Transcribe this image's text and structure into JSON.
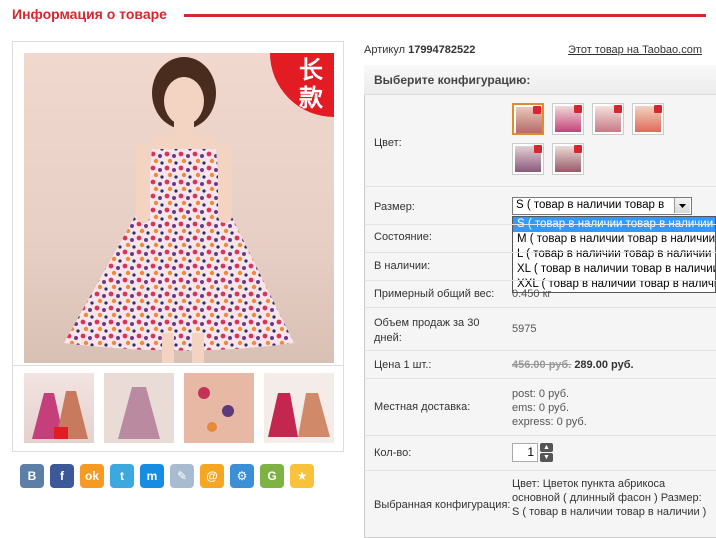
{
  "header": {
    "title": "Информация о товаре"
  },
  "gallery": {
    "badge": "长\n款",
    "thumbnails": [
      "thumb-1",
      "thumb-2",
      "thumb-3",
      "thumb-4"
    ]
  },
  "share": [
    {
      "name": "vk",
      "label": "B",
      "color": "#5b7fa6"
    },
    {
      "name": "facebook",
      "label": "f",
      "color": "#3b5998"
    },
    {
      "name": "odnoklassniki",
      "label": "ok",
      "color": "#f59a22"
    },
    {
      "name": "twitter",
      "label": "t",
      "color": "#3da8de"
    },
    {
      "name": "mailru",
      "label": "m",
      "color": "#168de2"
    },
    {
      "name": "livejournal",
      "label": "✎",
      "color": "#a7bcd0"
    },
    {
      "name": "mail",
      "label": "@",
      "color": "#f5a623"
    },
    {
      "name": "settings",
      "label": "⚙",
      "color": "#3b8fd6"
    },
    {
      "name": "googleplus",
      "label": "G",
      "color": "#7cb342"
    },
    {
      "name": "favorites",
      "label": "★",
      "color": "#f8c33a"
    }
  ],
  "product": {
    "sku_label": "Артикул",
    "sku": "17994782522",
    "taobao_link": "Этот товар на Taobao.com"
  },
  "config": {
    "title": "Выберите конфигурацию:",
    "color_label": "Цвет:",
    "size_label": "Размер:",
    "size_selected": "S ( товар в наличии товар в",
    "size_options": [
      "S ( товар в наличии товар в наличии )",
      "M ( товар в наличии товар в наличии )",
      "L ( товар в наличии товар в наличии )",
      "XL ( товар в наличии товар в наличии )",
      "XXL ( товар в наличии товар в наличии )"
    ],
    "condition_label": "Состояние:",
    "stock_label": "В наличии:",
    "weight_label": "Примерный общий вес:",
    "weight_value": "0.450 кг",
    "sales_label": "Объем продаж за 30 дней:",
    "sales_value": "5975",
    "price_label": "Цена 1 шт.:",
    "price_old": "456.00 руб.",
    "price_new": "289.00 руб.",
    "delivery_label": "Местная доставка:",
    "delivery": [
      "post: 0 руб.",
      "ems: 0 руб.",
      "express: 0 руб."
    ],
    "qty_label": "Кол-во:",
    "qty": "1",
    "selected_label": "Выбранная конфигурация:",
    "selected_text": "Цвет: Цветок пункта абрикоса основной ( длинный фасон ) Размер: S ( товар в наличии товар в наличии )"
  }
}
